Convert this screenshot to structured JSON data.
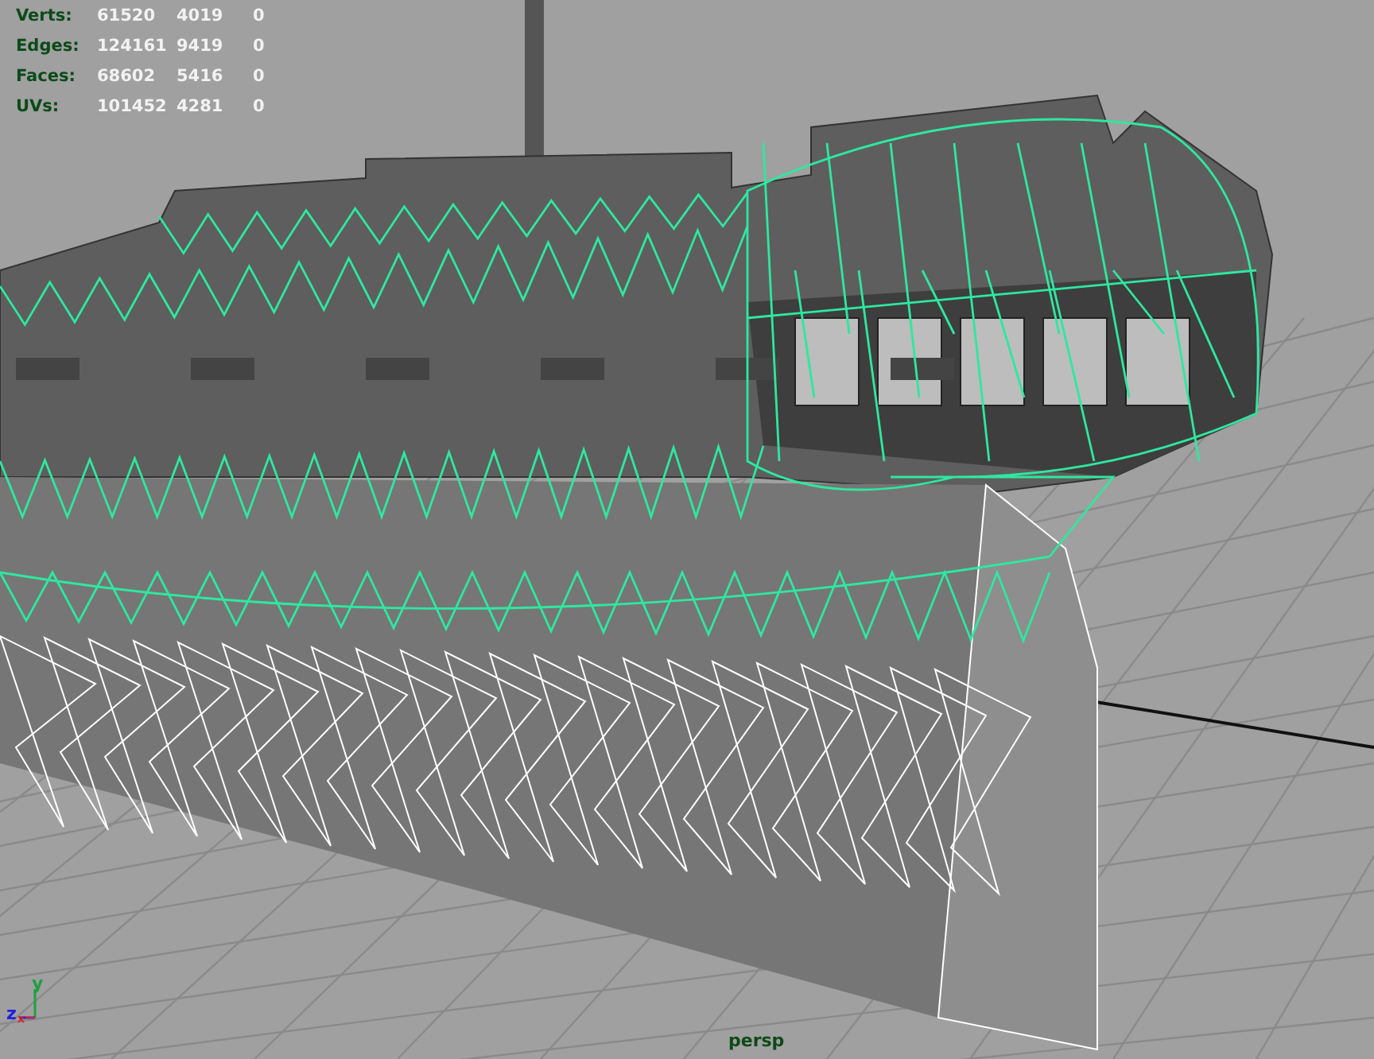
{
  "hud": [
    {
      "label": "Verts:",
      "values": [
        "61520",
        "4019",
        "0"
      ]
    },
    {
      "label": "Edges:",
      "values": [
        "124161",
        "9419",
        "0"
      ]
    },
    {
      "label": "Faces:",
      "values": [
        "68602",
        "5416",
        "0"
      ]
    },
    {
      "label": "UVs:",
      "values": [
        "101452",
        "4281",
        "0"
      ]
    }
  ],
  "axes": {
    "y": "y",
    "z": "z",
    "x": "x"
  },
  "camera": "persp"
}
